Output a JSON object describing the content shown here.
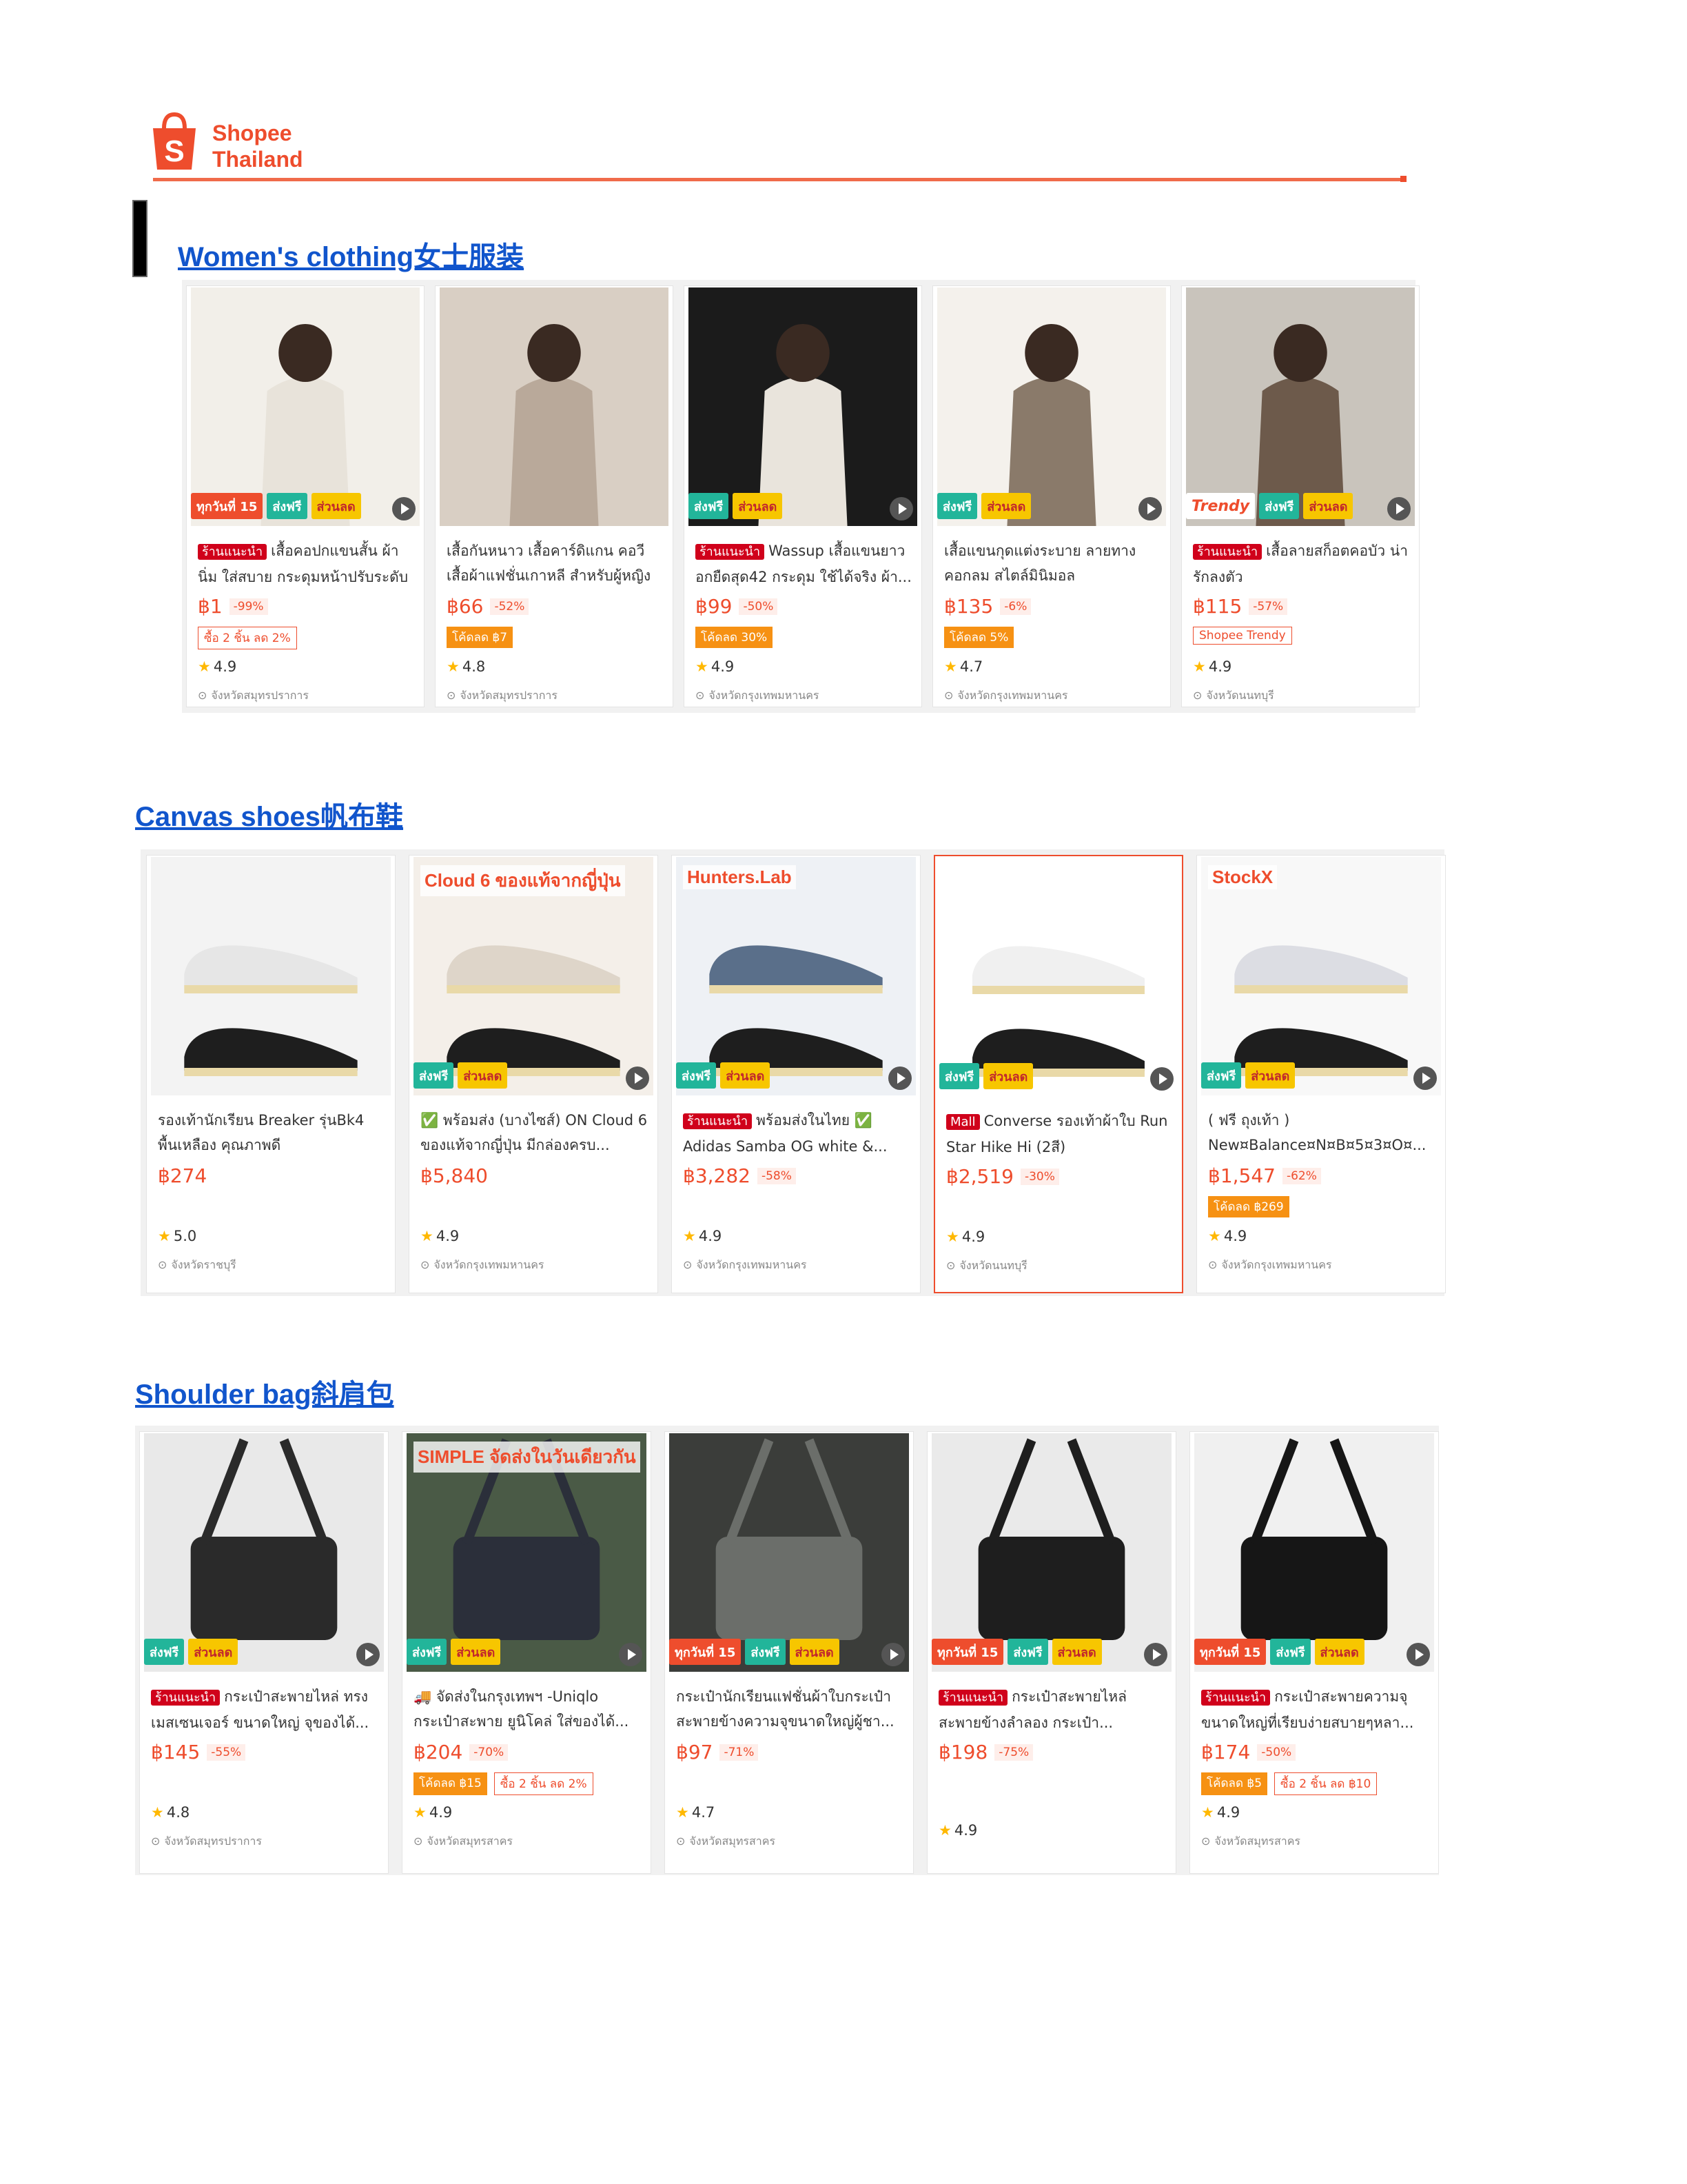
{
  "header": {
    "brand_line1": "Shopee",
    "brand_line2": "Thailand",
    "accent_color": "#ee4d2d"
  },
  "sections": [
    {
      "title": "Women's clothing女士服装",
      "products": [
        {
          "badge": "ร้านแนะนำ",
          "title": "เสื้อคอปกแขนสั้น ผ้านิ่ม ใส่สบาย กระดุมหน้าปรับระดับ ลา...",
          "price": "฿1",
          "discount": "-99%",
          "chips": [
            {
              "text": "ซื้อ 2 ชิ้น ลด 2%",
              "style": "outline"
            }
          ],
          "rating": "4.9",
          "location": "จังหวัดสมุทรปราการ",
          "tags": [
            "ทุกวันที่ 15",
            "ส่งฟรี",
            "ส่วนลด"
          ]
        },
        {
          "badge": "",
          "title": "เสื้อกันหนาว เสื้อคาร์ดิแกน คอวี เสื้อผ้าแฟชั่นเกาหลี สำหรับผู้หญิง",
          "price": "฿66",
          "discount": "-52%",
          "chips": [
            {
              "text": "โค้ดลด ฿7",
              "style": "fill"
            }
          ],
          "rating": "4.8",
          "location": "จังหวัดสมุทรปราการ",
          "tags": []
        },
        {
          "badge": "ร้านแนะนำ",
          "title": "Wassup เสื้อแขนยาวอกยืดสุด42 กระดุม ใช้ได้จริง ผ้า...",
          "price": "฿99",
          "discount": "-50%",
          "chips": [
            {
              "text": "โค้ดลด 30%",
              "style": "fill"
            }
          ],
          "rating": "4.9",
          "location": "จังหวัดกรุงเทพมหานคร",
          "tags": [
            "ส่งฟรี",
            "ส่วนลด"
          ]
        },
        {
          "badge": "",
          "title": "เสื้อแขนกุดแต่งระบาย ลายทาง คอกลม สไตล์มินิมอล",
          "price": "฿135",
          "discount": "-6%",
          "chips": [
            {
              "text": "โค้ดลด 5%",
              "style": "fill"
            }
          ],
          "rating": "4.7",
          "location": "จังหวัดกรุงเทพมหานคร",
          "tags": [
            "ส่งฟรี",
            "ส่วนลด"
          ]
        },
        {
          "badge": "ร้านแนะนำ",
          "title": "เสื้อลายสก็อตคอบัว น่ารักลงตัว",
          "price": "฿115",
          "discount": "-57%",
          "chips": [
            {
              "text": "Shopee Trendy",
              "style": "outline"
            }
          ],
          "rating": "4.9",
          "location": "จังหวัดนนทบุรี",
          "tags": [
            "Trendy",
            "ส่งฟรี",
            "ส่วนลด"
          ]
        }
      ]
    },
    {
      "title": "Canvas shoes帆布鞋",
      "products": [
        {
          "badge": "",
          "title": "รองเท้านักเรียน Breaker รุ่นBk4 พื้นเหลือง คุณภาพดี",
          "price": "฿274",
          "discount": "",
          "chips": [],
          "rating": "5.0",
          "location": "จังหวัดราชบุรี",
          "tags": []
        },
        {
          "badge": "",
          "title": "✅ พร้อมส่ง (บางไซส์) ON Cloud 6 ของแท้จากญี่ปุ่น มีกล่องครบ...",
          "price": "฿5,840",
          "discount": "",
          "chips": [],
          "rating": "4.9",
          "location": "จังหวัดกรุงเทพมหานคร",
          "tags": [
            "ส่งฟรี",
            "ส่วนลด"
          ],
          "overlay": "Cloud 6 ของแท้จากญี่ปุ่น"
        },
        {
          "badge": "ร้านแนะนำ",
          "title": "พร้อมส่งในไทย ✅ Adidas Samba OG white &...",
          "price": "฿3,282",
          "discount": "-58%",
          "chips": [],
          "rating": "4.9",
          "location": "จังหวัดกรุงเทพมหานคร",
          "tags": [
            "ส่งฟรี",
            "ส่วนลด"
          ],
          "overlay": "Hunters.Lab"
        },
        {
          "badge": "Mall",
          "title": "Converse รองเท้าผ้าใบ Run Star Hike Hi (2สี)",
          "price": "฿2,519",
          "discount": "-30%",
          "chips": [],
          "rating": "4.9",
          "location": "จังหวัดนนทบุรี",
          "tags": [
            "ส่งฟรี",
            "ส่วนลด"
          ]
        },
        {
          "badge": "",
          "title": "( ฟรี ถุงเท้า ) New¤Balance¤N¤B¤5¤3¤O¤...",
          "price": "฿1,547",
          "discount": "-62%",
          "chips": [
            {
              "text": "โค้ดลด ฿269",
              "style": "fill"
            }
          ],
          "rating": "4.9",
          "location": "จังหวัดกรุงเทพมหานคร",
          "tags": [
            "ส่งฟรี",
            "ส่วนลด"
          ],
          "overlay": "StockX"
        }
      ]
    },
    {
      "title": "Shoulder bag斜肩包",
      "products": [
        {
          "badge": "ร้านแนะนำ",
          "title": "กระเป๋าสะพายไหล่ ทรงเมสเซนเจอร์ ขนาดใหญ่ จุของได้...",
          "price": "฿145",
          "discount": "-55%",
          "chips": [],
          "rating": "4.8",
          "location": "จังหวัดสมุทรปราการ",
          "tags": [
            "ส่งฟรี",
            "ส่วนลด"
          ]
        },
        {
          "badge": "",
          "title": "🚚 จัดส่งในกรุงเทพฯ -Uniqlo กระเป๋าสะพาย ยูนิโคล่ ใส่ของได้...",
          "price": "฿204",
          "discount": "-70%",
          "chips": [
            {
              "text": "โค้ดลด ฿15",
              "style": "fill"
            },
            {
              "text": "ซื้อ 2 ชิ้น ลด 2%",
              "style": "outline"
            }
          ],
          "rating": "4.9",
          "location": "จังหวัดสมุทรสาคร",
          "tags": [
            "ส่งฟรี",
            "ส่วนลด"
          ],
          "overlay": "SIMPLE จัดส่งในวันเดียวกัน"
        },
        {
          "badge": "",
          "title": "กระเป๋านักเรียนแฟชั่นผ้าใบกระเป๋าสะพายข้างความจุขนาดใหญ่ผู้ชา...",
          "price": "฿97",
          "discount": "-71%",
          "chips": [],
          "rating": "4.7",
          "location": "จังหวัดสมุทรสาคร",
          "tags": [
            "ทุกวันที่ 15",
            "ส่งฟรี",
            "ส่วนลด"
          ]
        },
        {
          "badge": "ร้านแนะนำ",
          "title": "กระเป๋าสะพายไหล่ สะพายข้างลำลอง กระเป๋า...",
          "price": "฿198",
          "discount": "-75%",
          "chips": [],
          "rating": "4.9",
          "location": "",
          "tags": [
            "ทุกวันที่ 15",
            "ส่งฟรี",
            "ส่วนลด"
          ]
        },
        {
          "badge": "ร้านแนะนำ",
          "title": "กระเป๋าสะพายความจุขนาดใหญ่ที่เรียบง่ายสบายๆหลา...",
          "price": "฿174",
          "discount": "-50%",
          "chips": [
            {
              "text": "โค้ดลด ฿5",
              "style": "fill"
            },
            {
              "text": "ซื้อ 2 ชิ้น ลด ฿10",
              "style": "outline"
            }
          ],
          "rating": "4.9",
          "location": "จังหวัดสมุทรสาคร",
          "tags": [
            "ทุกวันที่ 15",
            "ส่งฟรี",
            "ส่วนลด"
          ]
        }
      ]
    }
  ]
}
